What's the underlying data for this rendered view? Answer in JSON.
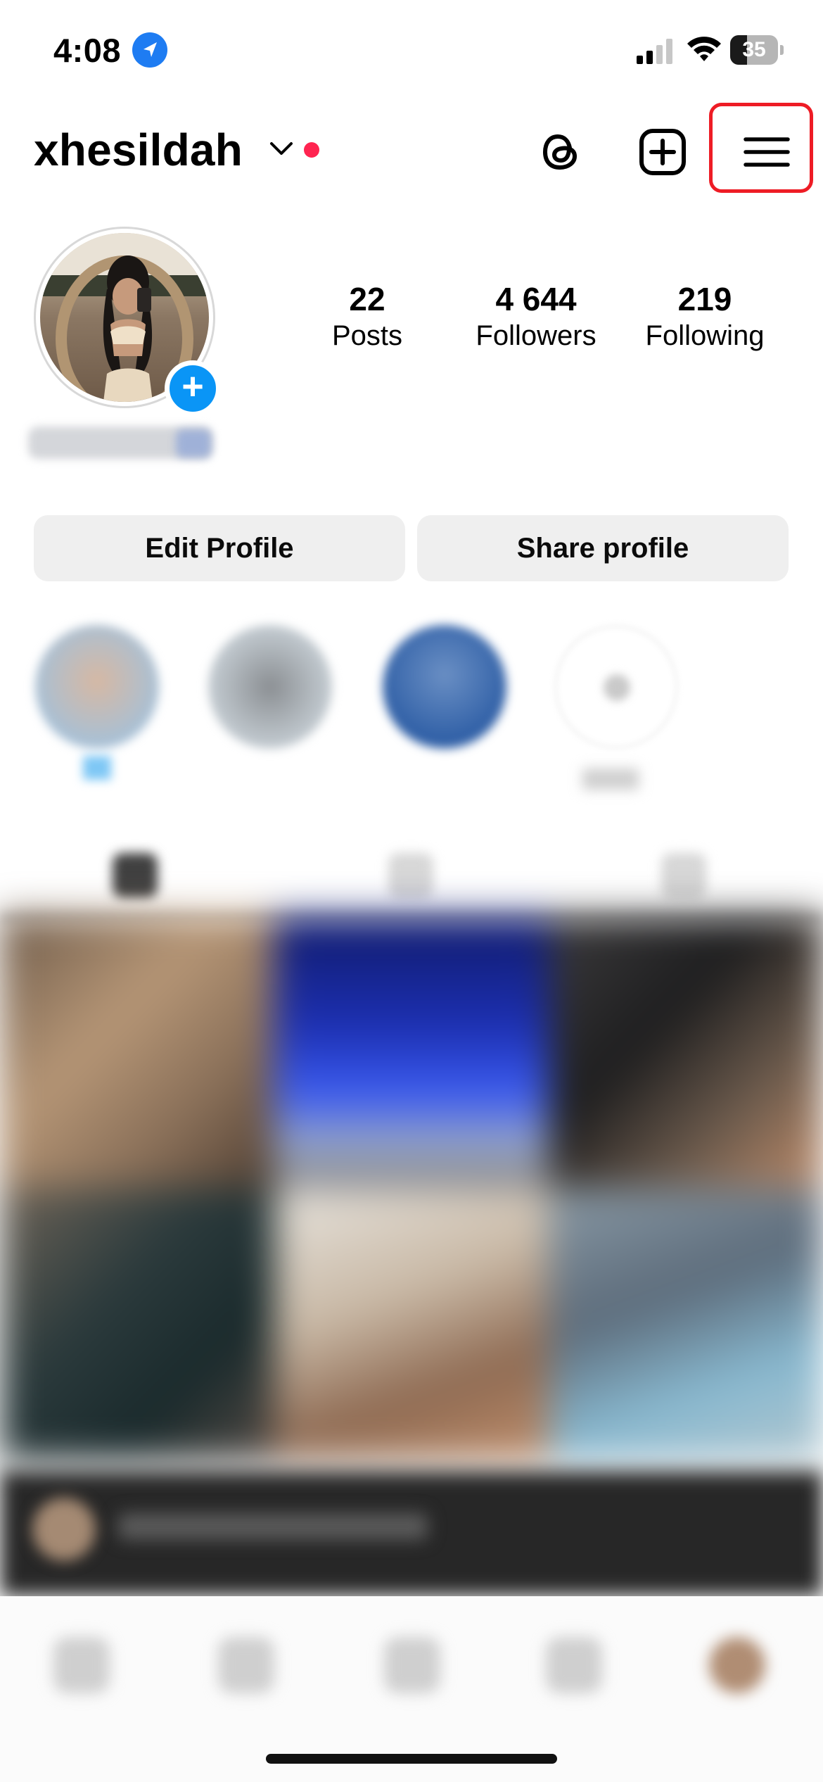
{
  "status_bar": {
    "time": "4:08",
    "battery_level": "35",
    "icons": [
      "location-arrow-icon",
      "cellular-signal-icon",
      "wifi-icon",
      "battery-icon"
    ]
  },
  "header": {
    "username": "xhesildah",
    "icons": [
      "chevron-down-icon",
      "threads-icon",
      "new-post-icon",
      "menu-icon"
    ],
    "notification_dot_color": "#ff2450",
    "highlight_box_color": "#ee1c25"
  },
  "profile": {
    "stats": [
      {
        "value": "22",
        "label": "Posts"
      },
      {
        "value": "4 644",
        "label": "Followers"
      },
      {
        "value": "219",
        "label": "Following"
      }
    ]
  },
  "buttons": {
    "edit_profile": "Edit Profile",
    "share_profile": "Share profile"
  },
  "colors": {
    "accent_blue": "#0a95f6",
    "button_bg": "#efefef"
  }
}
